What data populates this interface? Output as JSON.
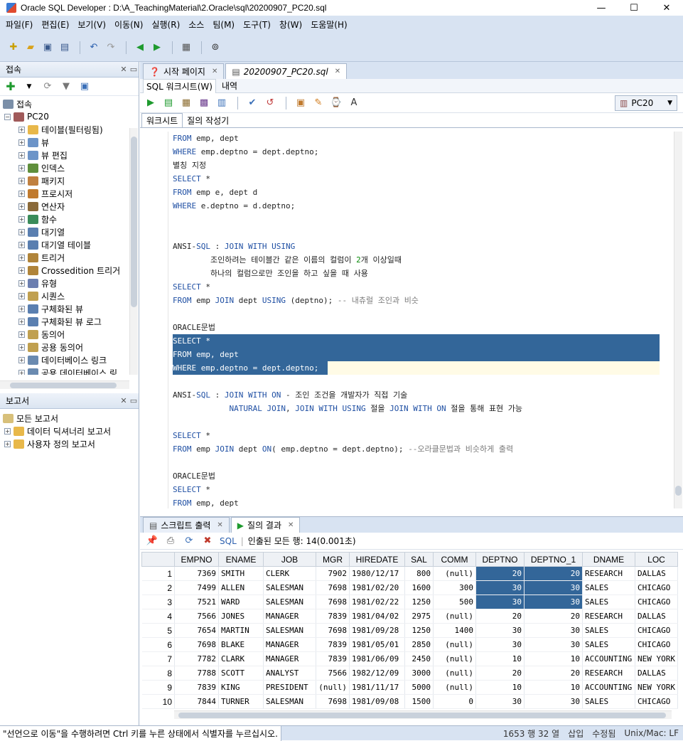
{
  "window": {
    "title": "Oracle SQL Developer : D:\\A_TeachingMaterial\\2.Oracle\\sql\\20200907_PC20.sql",
    "min": "—",
    "max": "☐",
    "close": "✕"
  },
  "menu": [
    "파일(F)",
    "편집(E)",
    "보기(V)",
    "이동(N)",
    "실행(R)",
    "소스",
    "팀(M)",
    "도구(T)",
    "창(W)",
    "도움말(H)"
  ],
  "connections_panel": {
    "title": "접속",
    "root": "접속",
    "connection": "PC20",
    "items": [
      "테이블(필터링됨)",
      "뷰",
      "뷰 편집",
      "인덱스",
      "패키지",
      "프로시저",
      "연산자",
      "함수",
      "대기열",
      "대기열 테이블",
      "트리거",
      "Crossedition 트리거",
      "유형",
      "시퀀스",
      "구체화된 뷰",
      "구체화된 뷰 로그",
      "동의어",
      "공용 동의어",
      "데이터베이스 링크",
      "공용 데이터베이스 링"
    ]
  },
  "reports_panel": {
    "title": "보고서",
    "items": [
      "모든 보고서",
      "데이터 딕셔너리 보고서",
      "사용자 정의 보고서"
    ]
  },
  "editor_tabs": [
    {
      "label": "시작 페이지"
    },
    {
      "label": "20200907_PC20.sql"
    }
  ],
  "sub_tabs": [
    "SQL 워크시트(W)",
    "내역"
  ],
  "connection_select": "PC20",
  "worksheet_tabs": [
    "워크시트",
    "질의 작성기"
  ],
  "code_lines": [
    "FROM emp, dept",
    "WHERE emp.deptno = dept.deptno;",
    "별칭 지정",
    "SELECT *",
    "FROM emp e, dept d",
    "WHERE e.deptno = d.deptno;",
    "",
    "",
    "ANSI-SQL : JOIN WITH USING",
    "        조인하려는 테이블간 같은 이름의 컬럼이 2개 이상일때",
    "        하나의 컬럼으로만 조인을 하고 싶을 때 사용",
    "SELECT *",
    "FROM emp JOIN dept USING (deptno); -- 내츄럴 조인과 비슷",
    "",
    "ORACLE문법",
    "SELECT *",
    "FROM emp, dept",
    "WHERE emp.deptno = dept.deptno;",
    "",
    "ANSI-SQL : JOIN WITH ON - 조인 조건을 개발자가 직접 기술",
    "            NATURAL JOIN, JOIN WITH USING 절을 JOIN WITH ON 절을 통해 표현 가능",
    "",
    "SELECT *",
    "FROM emp JOIN dept ON( emp.deptno = dept.deptno); --오라클문법과 비슷하게 출력",
    "",
    "ORACLE문법",
    "SELECT *",
    "FROM emp, dept"
  ],
  "result_tabs": [
    {
      "label": "스크립트 출력"
    },
    {
      "label": "질의 결과"
    }
  ],
  "result_toolbar": {
    "sql": "SQL",
    "fetched": "인출된 모든 행: 14(0.001초)"
  },
  "grid": {
    "columns": [
      "EMPNO",
      "ENAME",
      "JOB",
      "MGR",
      "HIREDATE",
      "SAL",
      "COMM",
      "DEPTNO",
      "DEPTNO_1",
      "DNAME",
      "LOC"
    ],
    "rows": [
      [
        "1",
        "7369",
        "SMITH",
        "CLERK",
        "7902",
        "1980/12/17",
        "800",
        "(null)",
        "20",
        "20",
        "RESEARCH",
        "DALLAS"
      ],
      [
        "2",
        "7499",
        "ALLEN",
        "SALESMAN",
        "7698",
        "1981/02/20",
        "1600",
        "300",
        "30",
        "30",
        "SALES",
        "CHICAGO"
      ],
      [
        "3",
        "7521",
        "WARD",
        "SALESMAN",
        "7698",
        "1981/02/22",
        "1250",
        "500",
        "30",
        "30",
        "SALES",
        "CHICAGO"
      ],
      [
        "4",
        "7566",
        "JONES",
        "MANAGER",
        "7839",
        "1981/04/02",
        "2975",
        "(null)",
        "20",
        "20",
        "RESEARCH",
        "DALLAS"
      ],
      [
        "5",
        "7654",
        "MARTIN",
        "SALESMAN",
        "7698",
        "1981/09/28",
        "1250",
        "1400",
        "30",
        "30",
        "SALES",
        "CHICAGO"
      ],
      [
        "6",
        "7698",
        "BLAKE",
        "MANAGER",
        "7839",
        "1981/05/01",
        "2850",
        "(null)",
        "30",
        "30",
        "SALES",
        "CHICAGO"
      ],
      [
        "7",
        "7782",
        "CLARK",
        "MANAGER",
        "7839",
        "1981/06/09",
        "2450",
        "(null)",
        "10",
        "10",
        "ACCOUNTING",
        "NEW YORK"
      ],
      [
        "8",
        "7788",
        "SCOTT",
        "ANALYST",
        "7566",
        "1982/12/09",
        "3000",
        "(null)",
        "20",
        "20",
        "RESEARCH",
        "DALLAS"
      ],
      [
        "9",
        "7839",
        "KING",
        "PRESIDENT",
        "(null)",
        "1981/11/17",
        "5000",
        "(null)",
        "10",
        "10",
        "ACCOUNTING",
        "NEW YORK"
      ],
      [
        "10",
        "7844",
        "TURNER",
        "SALESMAN",
        "7698",
        "1981/09/08",
        "1500",
        "0",
        "30",
        "30",
        "SALES",
        "CHICAGO"
      ]
    ]
  },
  "status": {
    "message": "\"선언으로 이동\"을 수행하려면 Ctrl 키를 누른 상태에서 식별자를 누르십시오.",
    "position": "1653 행 32 열",
    "insert": "삽입",
    "modified": "수정됨",
    "eol": "Unix/Mac: LF"
  }
}
